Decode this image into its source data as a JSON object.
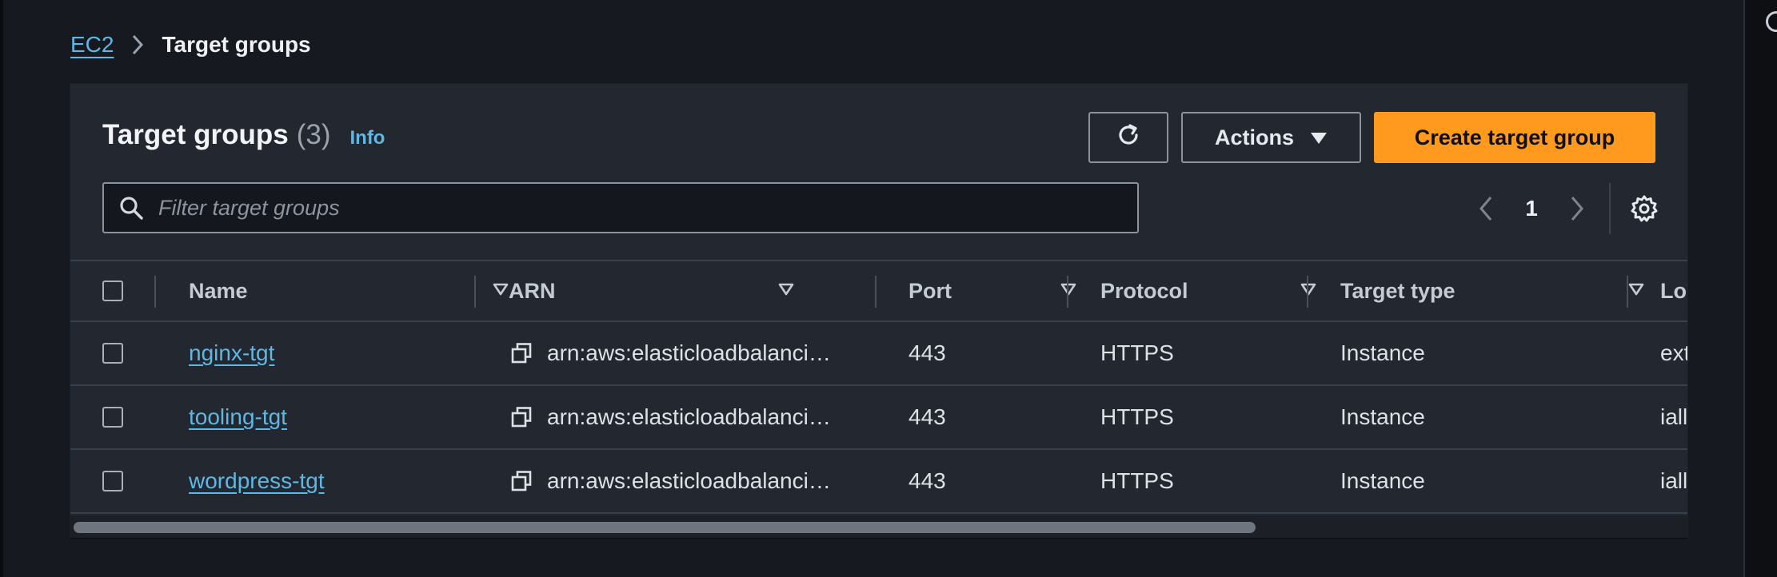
{
  "breadcrumb": {
    "root": "EC2",
    "current": "Target groups"
  },
  "panel": {
    "title": "Target groups",
    "count": "(3)",
    "info": "Info",
    "actions_label": "Actions",
    "create_label": "Create target group",
    "filter_placeholder": "Filter target groups",
    "page_number": "1"
  },
  "table": {
    "columns": [
      "Name",
      "ARN",
      "Port",
      "Protocol",
      "Target type",
      "Lo"
    ],
    "rows": [
      {
        "name": "nginx-tgt",
        "arn": "arn:aws:elasticloadbalanci…",
        "port": "443",
        "protocol": "HTTPS",
        "target_type": "Instance",
        "lb": "ext"
      },
      {
        "name": "tooling-tgt",
        "arn": "arn:aws:elasticloadbalanci…",
        "port": "443",
        "protocol": "HTTPS",
        "target_type": "Instance",
        "lb": "iall"
      },
      {
        "name": "wordpress-tgt",
        "arn": "arn:aws:elasticloadbalanci…",
        "port": "443",
        "protocol": "HTTPS",
        "target_type": "Instance",
        "lb": "iall"
      }
    ]
  },
  "icons": [
    "chevron-right-icon",
    "refresh-icon",
    "caret-down-icon",
    "search-icon",
    "chevron-left-icon",
    "gear-icon",
    "sort-caret-icon",
    "copy-icon"
  ],
  "colors": {
    "accent": "#ff9a1f",
    "link": "#5fb7e3",
    "background": "#16191f",
    "panel": "#232830"
  }
}
